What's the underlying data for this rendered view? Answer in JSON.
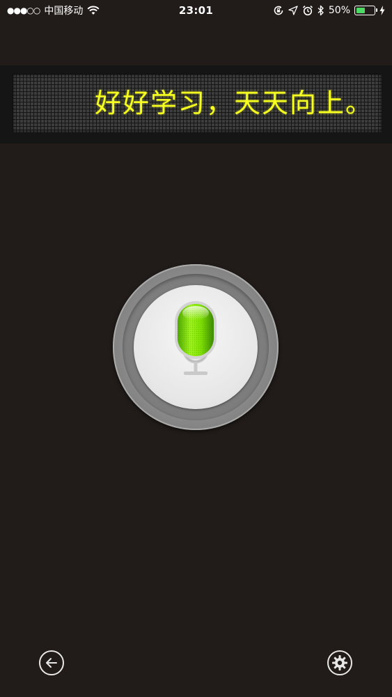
{
  "status_bar": {
    "signal_dots": "●●●○○",
    "carrier": "中国移动",
    "time": "23:01",
    "battery_percent": "50%",
    "battery_level": 0.5,
    "icons": [
      "wifi-icon",
      "rotation-lock-icon",
      "location-icon",
      "alarm-icon",
      "bluetooth-icon",
      "battery-icon",
      "charging-icon"
    ]
  },
  "display": {
    "text": "好好学习，天天向上。",
    "text_color": "#f6ff1f"
  },
  "mic": {
    "icon": "microphone-icon",
    "accent": "#7ee000"
  },
  "controls": {
    "back_icon": "back-arrow-icon",
    "settings_icon": "gear-icon"
  },
  "colors": {
    "background": "#211c19",
    "battery_fill": "#4cd964"
  }
}
